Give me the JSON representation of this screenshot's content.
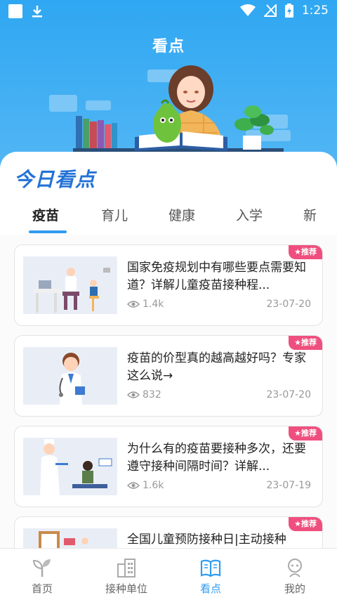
{
  "status_bar": {
    "time": "1:25"
  },
  "header": {
    "title": "看点"
  },
  "section": {
    "title": "今日看点"
  },
  "tabs": [
    {
      "label": "疫苗",
      "active": true
    },
    {
      "label": "育儿",
      "active": false
    },
    {
      "label": "健康",
      "active": false
    },
    {
      "label": "入学",
      "active": false
    },
    {
      "label": "新",
      "active": false
    }
  ],
  "articles": [
    {
      "badge": "推荐",
      "title": "国家免疫规划中有哪些要点需要知道？详解儿童疫苗接种程...",
      "views": "1.4k",
      "date": "23-07-20",
      "thumb_icon": "doctor-examining-child-illustration"
    },
    {
      "badge": "推荐",
      "title": "疫苗的价型真的越高越好吗？专家这么说→",
      "views": "832",
      "date": "23-07-20",
      "thumb_icon": "doctor-with-stethoscope-illustration"
    },
    {
      "badge": "推荐",
      "title": "为什么有的疫苗要接种多次，还要遵守接种间隔时间？详解...",
      "views": "1.6k",
      "date": "23-07-19",
      "thumb_icon": "nurse-vaccinating-child-illustration"
    },
    {
      "badge": "推荐",
      "title": "全国儿童预防接种日|主动接种",
      "views": "",
      "date": "",
      "thumb_icon": "clinic-room-illustration"
    }
  ],
  "bottom_nav": [
    {
      "label": "首页",
      "icon": "sprout-icon",
      "active": false
    },
    {
      "label": "接种单位",
      "icon": "building-icon",
      "active": false
    },
    {
      "label": "看点",
      "icon": "open-book-icon",
      "active": true
    },
    {
      "label": "我的",
      "icon": "profile-icon",
      "active": false
    }
  ],
  "colors": {
    "primary": "#2f9cf0",
    "header_top": "#2fa7f2",
    "badge": "#ef4f7e",
    "section_title": "#2473d6"
  }
}
